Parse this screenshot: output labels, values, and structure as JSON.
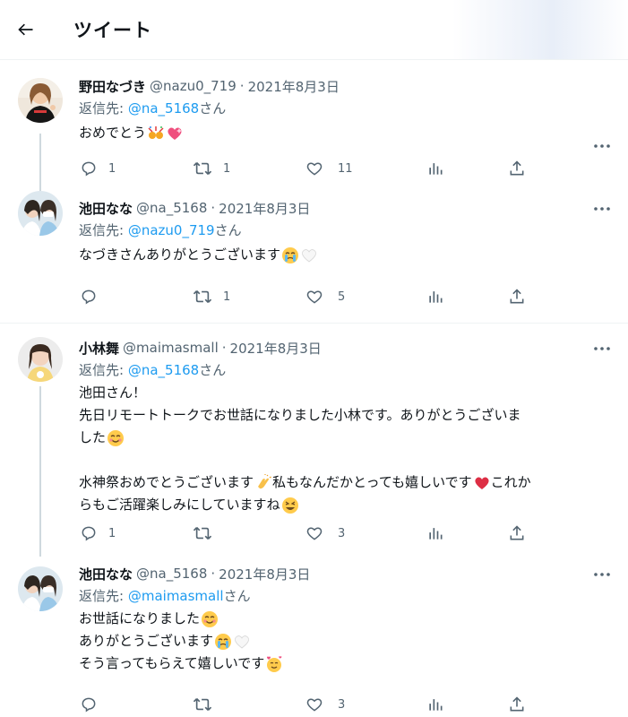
{
  "header": {
    "title": "ツイート"
  },
  "tweets": [
    {
      "name": "野田なづき",
      "handle": "@nazu0_719",
      "dot": "·",
      "date": "2021年8月3日",
      "reply_label": "返信先:",
      "reply_mention": "@na_5168",
      "reply_suffix": "さん",
      "lines": [
        "おめでとう"
      ],
      "emojis": [
        "celebrate-emoji",
        "sparkling-heart-emoji"
      ],
      "reply_count": "1",
      "retweet_count": "1",
      "like_count": "11"
    },
    {
      "name": "池田なな",
      "handle": "@na_5168",
      "dot": "·",
      "date": "2021年8月3日",
      "reply_label": "返信先:",
      "reply_mention": "@nazu0_719",
      "reply_suffix": "さん",
      "lines": [
        "なづきさんありがとうございます"
      ],
      "emojis": [
        "crying-face-emoji",
        "white-heart-emoji"
      ],
      "reply_count": "",
      "retweet_count": "1",
      "like_count": "5"
    },
    {
      "name": "小林舞",
      "handle": "@maimasmall",
      "dot": "·",
      "date": "2021年8月3日",
      "reply_label": "返信先:",
      "reply_mention": "@na_5168",
      "reply_suffix": "さん",
      "lines": [
        "池田さん！",
        "先日リモートトークでお世話になりました小林です。ありがとうございま",
        "した",
        "",
        "水神祭おめでとうございます",
        "私もなんだかとっても嬉しいです",
        "これか",
        "らもご活躍楽しみにしていますね"
      ],
      "emojis": [
        "smiling-face-emoji",
        "clapping-hands-emoji",
        "red-heart-emoji",
        "laughing-face-emoji"
      ],
      "reply_count": "1",
      "retweet_count": "",
      "like_count": "3"
    },
    {
      "name": "池田なな",
      "handle": "@na_5168",
      "dot": "·",
      "date": "2021年8月3日",
      "reply_label": "返信先:",
      "reply_mention": "@maimasmall",
      "reply_suffix": "さん",
      "lines": [
        "お世話になりました",
        "ありがとうございます",
        "そう言ってもらえて嬉しいです"
      ],
      "emojis": [
        "smiling-face-emoji",
        "crying-face-emoji",
        "white-heart-emoji",
        "smiling-hearts-emoji"
      ],
      "reply_count": "",
      "retweet_count": "",
      "like_count": "3"
    }
  ],
  "colors": {
    "text": "#0f1419",
    "secondary": "#536471",
    "link": "#1d9bf0",
    "divider": "#eff3f4",
    "thread_line": "#cfd9de"
  }
}
